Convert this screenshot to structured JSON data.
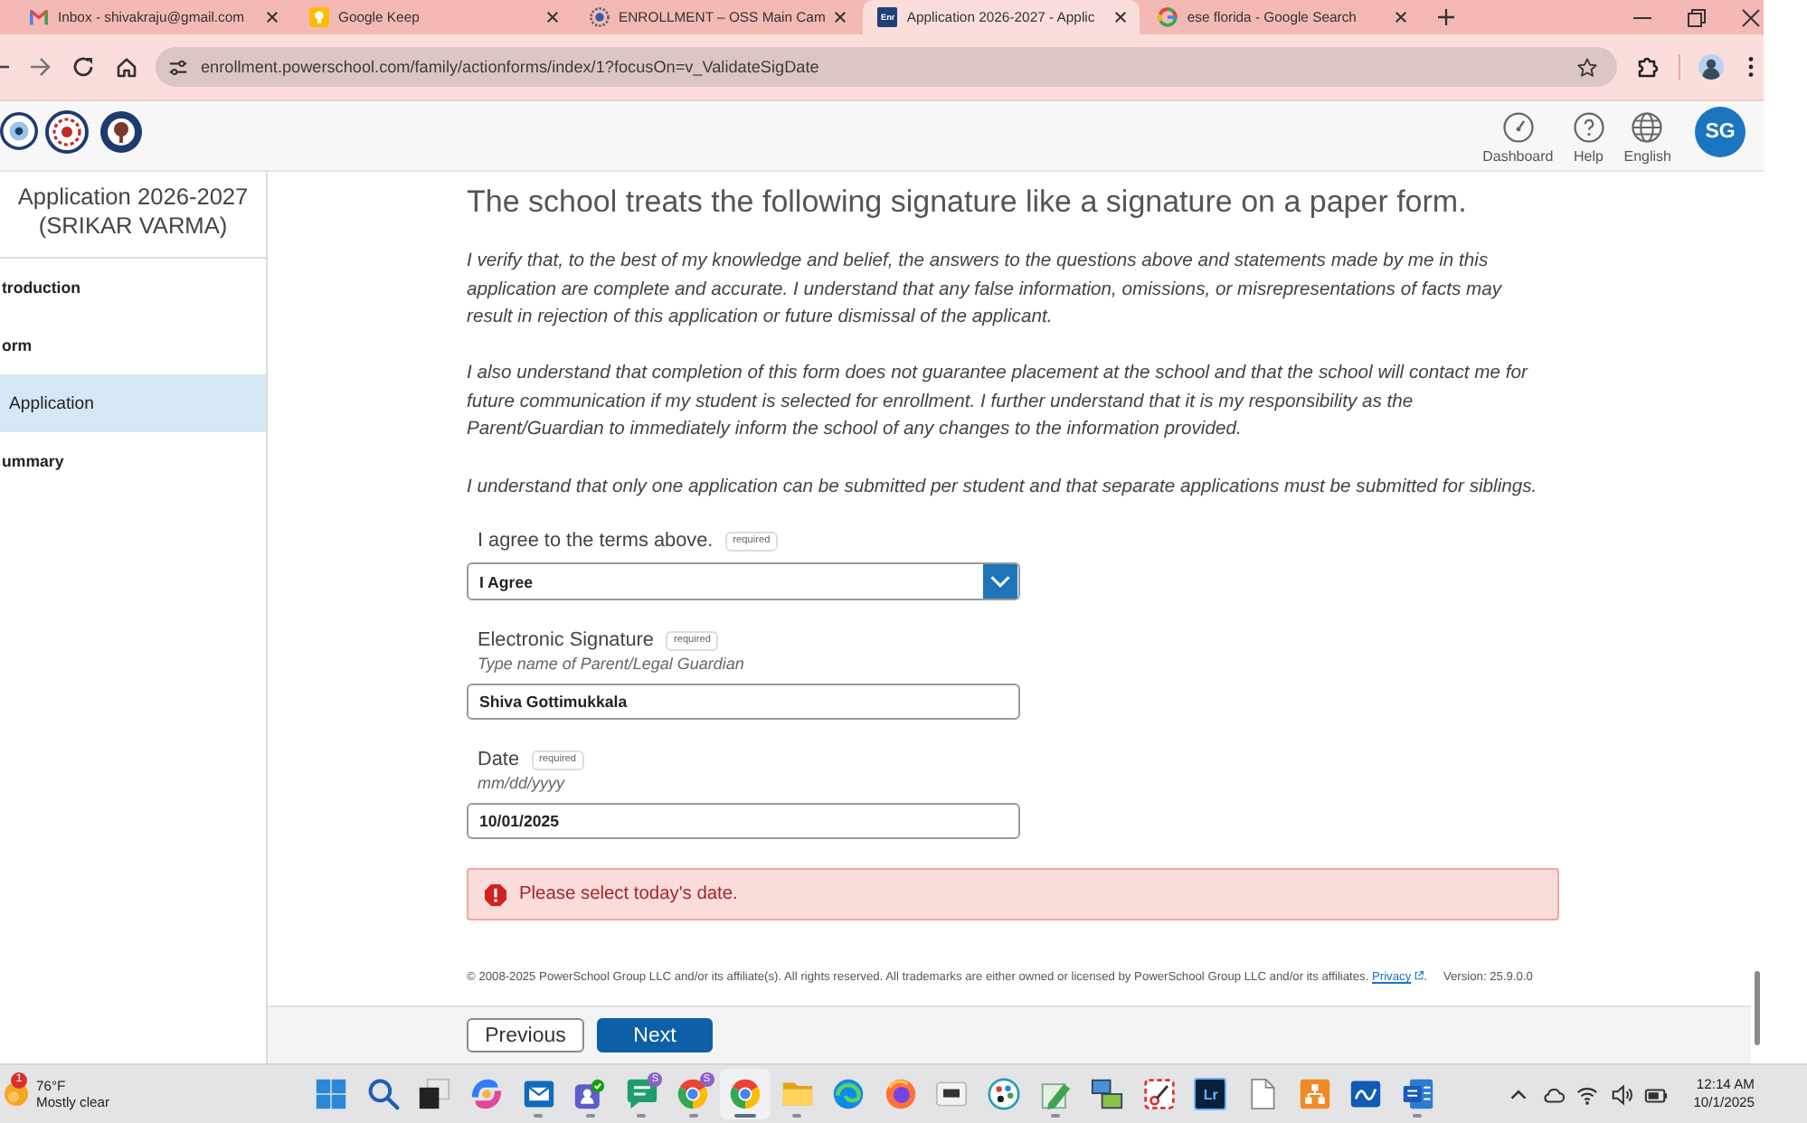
{
  "browser": {
    "tabs": [
      {
        "kind": "mail",
        "title": "Inbox - shivakraju@gmail.com",
        "selected": false
      },
      {
        "kind": "bulb",
        "title": "Google Keep",
        "selected": false
      },
      {
        "kind": "seal",
        "title": "ENROLLMENT – OSS Main Cam",
        "selected": false
      },
      {
        "kind": "lettered",
        "favicon_text": "Enr",
        "title": "Application 2026-2027 - Applic",
        "selected": true
      },
      {
        "kind": "search",
        "title": "ese florida - Google Search",
        "selected": false
      }
    ],
    "url": "enrollment.powerschool.com/family/actionforms/index/1?focusOn=v_ValidateSigDate"
  },
  "site_header": {
    "nav": [
      {
        "kind": "gauge",
        "label": "Dashboard"
      },
      {
        "kind": "help",
        "label": "Help"
      },
      {
        "kind": "globe",
        "label": "English"
      }
    ],
    "avatar": "SG"
  },
  "sidebar": {
    "title": "Application 2026-2027",
    "subtitle": "(SRIKAR VARMA)",
    "items": [
      {
        "label": "troduction",
        "selected": false
      },
      {
        "label": "orm",
        "selected": false
      },
      {
        "label": "Application",
        "selected": true
      },
      {
        "label": "ummary",
        "selected": false
      }
    ]
  },
  "form": {
    "heading": "The school treats the following signature like a signature on a paper form.",
    "paragraphs": [
      "I verify that, to the best of my knowledge and belief, the answers to the questions above and statements made by me in this application are complete and accurate. I understand that any false information, omissions, or misrepresentations of facts may result in rejection of this application or future dismissal of the applicant.",
      "I also understand that completion of this form does not guarantee placement at the school and that the school will contact me for future communication if my student is selected for enrollment. I further understand that it is my responsibility as the Parent/Guardian to immediately inform the school of any changes to the information provided.",
      "I understand that only one application can be submitted per student and that separate applications must be submitted for siblings."
    ],
    "fields": [
      {
        "kind": "select",
        "label": "I agree to the terms above.",
        "badge": "required",
        "value": "I Agree"
      },
      {
        "kind": "text",
        "label": "Electronic Signature",
        "badge": "required",
        "hint": "Type name of Parent/Legal Guardian",
        "value": "Shiva Gottimukkala"
      },
      {
        "kind": "text",
        "label": "Date",
        "badge": "required",
        "hint": "mm/dd/yyyy",
        "value": "10/01/2025"
      }
    ],
    "error": "Please select today's date."
  },
  "footer": {
    "copyright": "© 2008-2025 PowerSchool Group LLC and/or its affiliate(s). All rights reserved. All trademarks are either owned or licensed by PowerSchool Group LLC and/or its affiliates.",
    "link": "Privacy",
    "link_suffix": ".",
    "version": "Version: 25.9.0.0"
  },
  "nav_buttons": [
    {
      "kind": "secondary",
      "label": "Previous"
    },
    {
      "kind": "primary",
      "label": "Next"
    }
  ],
  "taskbar": {
    "weather": {
      "badge": "1",
      "temperature": "76°F",
      "condition": "Mostly clear"
    },
    "apps": [
      {
        "kind": "start",
        "running": false,
        "selected": false
      },
      {
        "kind": "search",
        "running": false,
        "selected": false
      },
      {
        "kind": "taskview",
        "running": false,
        "selected": false
      },
      {
        "kind": "swirl",
        "running": false,
        "selected": false
      },
      {
        "kind": "mail",
        "running": true,
        "selected": false
      },
      {
        "kind": "people",
        "running": true,
        "selected": false
      },
      {
        "kind": "chat",
        "running": true,
        "selected": false,
        "badge": "S"
      },
      {
        "kind": "wheel",
        "running": true,
        "selected": false,
        "badge": "S"
      },
      {
        "kind": "wheel",
        "running": true,
        "selected": true
      },
      {
        "kind": "folder",
        "running": true,
        "selected": false
      },
      {
        "kind": "wave",
        "running": false,
        "selected": false
      },
      {
        "kind": "fox",
        "running": false,
        "selected": false
      },
      {
        "kind": "terminal",
        "running": false,
        "selected": false
      },
      {
        "kind": "palette",
        "running": false,
        "selected": false
      },
      {
        "kind": "pencil",
        "running": true,
        "selected": false
      },
      {
        "kind": "computers",
        "running": false,
        "selected": false
      },
      {
        "kind": "scissors",
        "running": false,
        "selected": false
      },
      {
        "kind": "lettered",
        "text": "Lr",
        "running": false,
        "selected": false
      },
      {
        "kind": "document",
        "running": false,
        "selected": false
      },
      {
        "kind": "hierarchy",
        "running": false,
        "selected": false
      },
      {
        "kind": "whiteboard",
        "running": false,
        "selected": false
      },
      {
        "kind": "doctile",
        "running": true,
        "selected": false
      }
    ],
    "clock": {
      "time": "12:14 AM",
      "date": "10/1/2025"
    }
  }
}
